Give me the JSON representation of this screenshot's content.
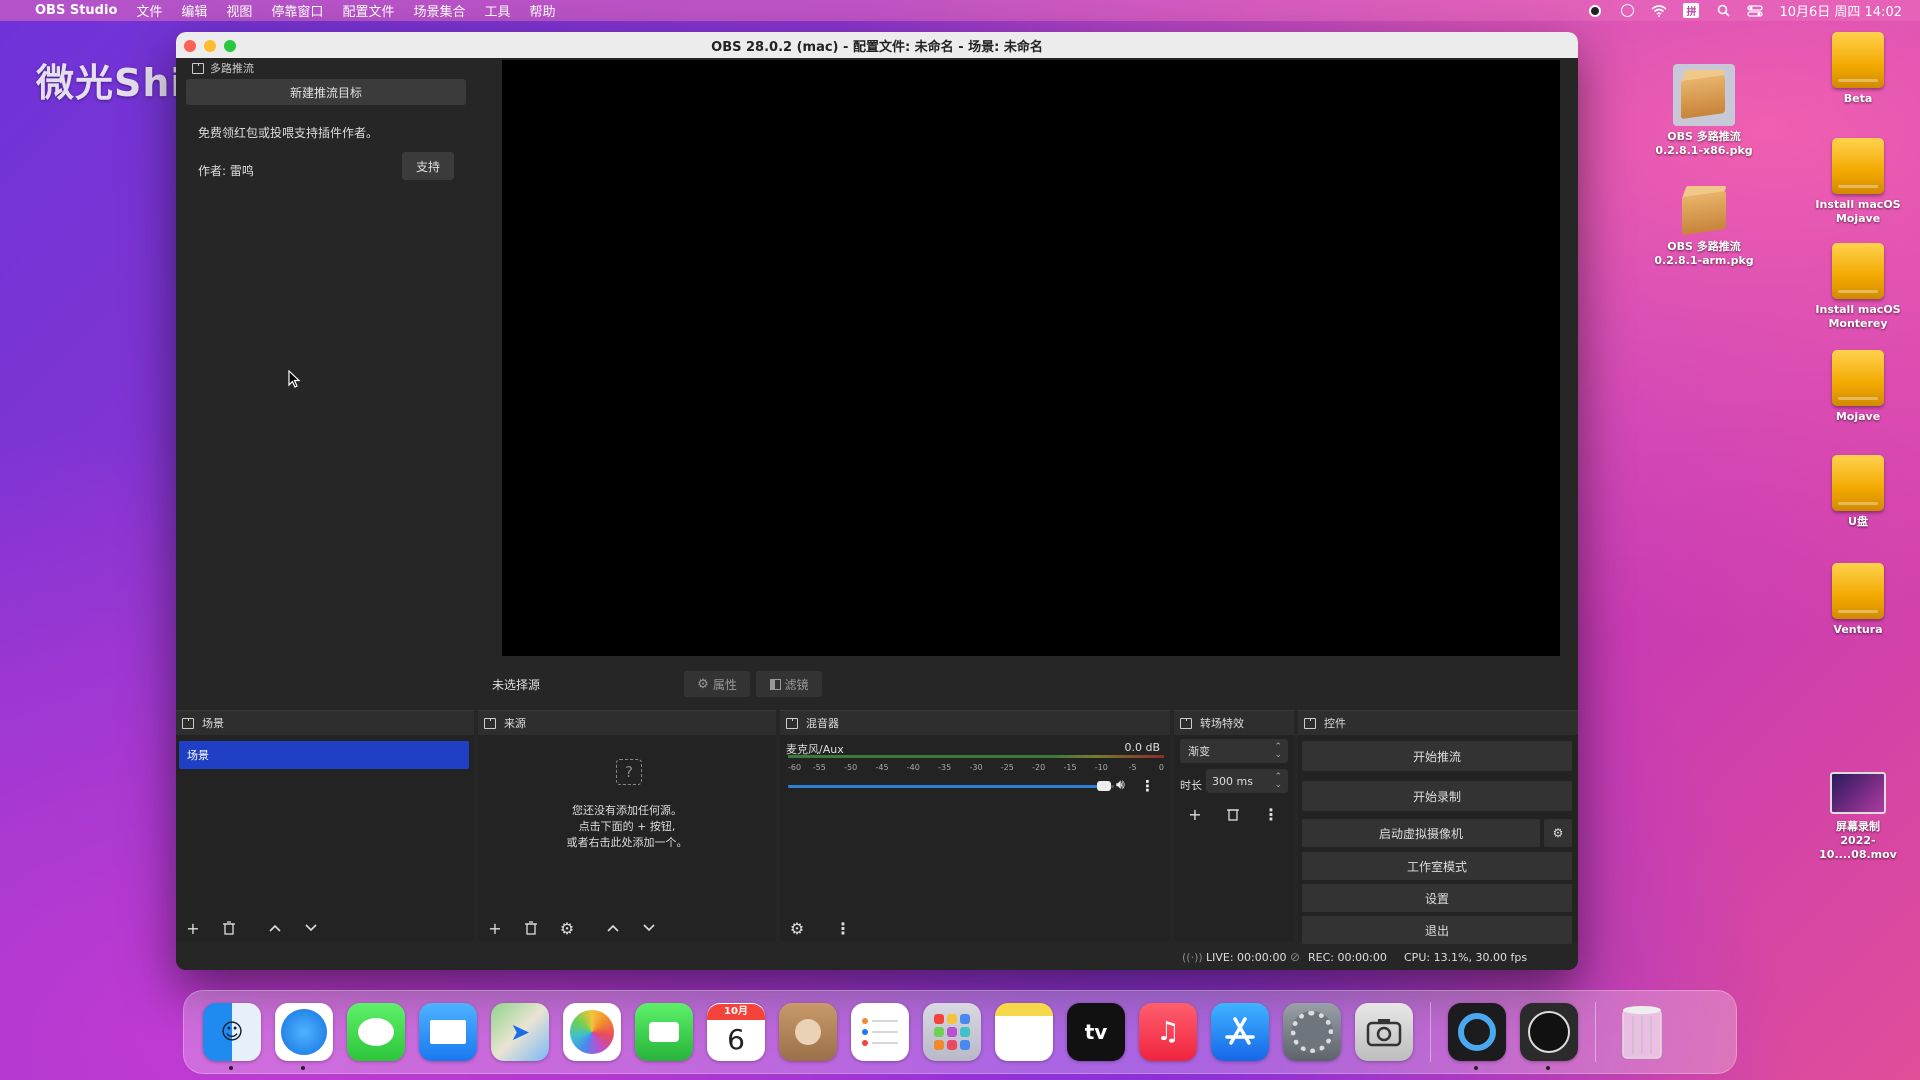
{
  "menubar": {
    "app_name": "OBS Studio",
    "items": [
      "文件",
      "编辑",
      "视图",
      "停靠窗口",
      "配置文件",
      "场景集合",
      "工具",
      "帮助"
    ],
    "ime": "拼",
    "clock": "10月6日 周四  14:02"
  },
  "watermark": "微光Shimmer-- bilibili",
  "window": {
    "title": "OBS 28.0.2 (mac) - 配置文件: 未命名 - 场景: 未命名",
    "left_panel": {
      "dock_title": "多路推流",
      "new_target_button": "新建推流目标",
      "support_text": "免费领红包或投喂支持插件作者。",
      "author": "作者: 雷鸣",
      "support_button": "支持"
    },
    "source_bar": {
      "no_source": "未选择源",
      "properties": "属性",
      "filters": "滤镜"
    },
    "scenes": {
      "title": "场景",
      "items": [
        "场景"
      ]
    },
    "sources": {
      "title": "来源",
      "empty_line1": "您还没有添加任何源。",
      "empty_line2": "点击下面的 + 按钮,",
      "empty_line3": "或者右击此处添加一个。"
    },
    "mixer": {
      "title": "混音器",
      "channel": "麦克风/Aux",
      "level": "0.0 dB",
      "ticks": [
        "-60",
        "-55",
        "-50",
        "-45",
        "-40",
        "-35",
        "-30",
        "-25",
        "-20",
        "-15",
        "-10",
        "-5",
        "0"
      ],
      "volume_fraction": 0.98
    },
    "transitions": {
      "title": "转场特效",
      "selected": "渐变",
      "duration_label": "时长",
      "duration_value": "300 ms"
    },
    "controls": {
      "title": "控件",
      "start_stream": "开始推流",
      "start_record": "开始录制",
      "virtual_cam": "启动虚拟摄像机",
      "studio_mode": "工作室模式",
      "settings": "设置",
      "exit": "退出"
    },
    "status": {
      "live": "LIVE: 00:00:00",
      "rec": "REC: 00:00:00",
      "cpu": "CPU: 13.1%, 30.00 fps"
    }
  },
  "desktop": {
    "pkg1_line1": "OBS 多路推流",
    "pkg1_line2": "0.2.8.1-x86.pkg",
    "pkg2_line1": "OBS 多路推流",
    "pkg2_line2": "0.2.8.1-arm.pkg",
    "beta": "Beta",
    "mojave_install_1": "Install macOS",
    "mojave_install_2": "Mojave",
    "monterey_install_1": "Install macOS",
    "monterey_install_2": "Monterey",
    "mojave": "Mojave",
    "udisk": "U盘",
    "ventura": "Ventura",
    "recording_1": "屏幕录制",
    "recording_2": "2022-10....08.mov"
  },
  "dock": {
    "calendar_month": "10月",
    "calendar_day": "6"
  }
}
